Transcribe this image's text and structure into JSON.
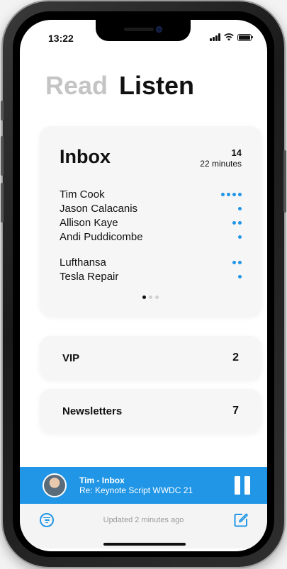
{
  "status": {
    "time": "13:22"
  },
  "tabs": {
    "read": "Read",
    "listen": "Listen"
  },
  "inbox": {
    "title": "Inbox",
    "count": "14",
    "duration": "22 minutes",
    "senders": [
      {
        "name": "Tim Cook",
        "dots": 4
      },
      {
        "name": "Jason Calacanis",
        "dots": 1
      },
      {
        "name": "Allison Kaye",
        "dots": 2
      },
      {
        "name": "Andi Puddicombe",
        "dots": 1
      },
      {
        "name": "Lufthansa",
        "dots": 2
      },
      {
        "name": "Tesla Repair",
        "dots": 1
      }
    ],
    "pager": {
      "pages": 3,
      "current": 1
    }
  },
  "vip": {
    "label": "VIP",
    "count": "2"
  },
  "newsletters": {
    "label": "Newsletters",
    "count": "7"
  },
  "player": {
    "title": "Tim - Inbox",
    "subtitle": "Re: Keynote Script WWDC 21"
  },
  "toolbar": {
    "updated": "Updated 2 minutes ago"
  },
  "colors": {
    "accent": "#2196e6",
    "card": "#f6f6f7",
    "inactive_tab": "#c4c4c4"
  },
  "icons": [
    "signal-icon",
    "wifi-icon",
    "battery-icon",
    "pause-icon",
    "filter-icon",
    "compose-icon"
  ]
}
